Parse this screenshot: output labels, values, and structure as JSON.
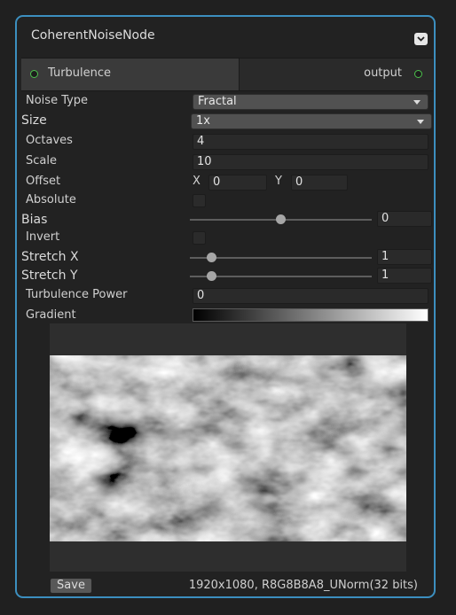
{
  "node": {
    "title": "CoherentNoiseNode",
    "collapse_icon": "chevron-down-icon",
    "accent_color": "#3c8fbf"
  },
  "ports": {
    "input_label": "Turbulence",
    "output_label": "output",
    "port_color": "#4cc24c"
  },
  "properties": {
    "noise_type": {
      "label": "Noise Type",
      "value": "Fractal"
    },
    "size": {
      "label": "Size",
      "value": "1x"
    },
    "octaves": {
      "label": "Octaves",
      "value": "4"
    },
    "scale": {
      "label": "Scale",
      "value": "10"
    },
    "offset": {
      "label": "Offset",
      "x_label": "X",
      "x_value": "0",
      "y_label": "Y",
      "y_value": "0"
    },
    "absolute": {
      "label": "Absolute",
      "checked": false
    },
    "bias": {
      "label": "Bias",
      "value": "0",
      "slider_fraction": 0.5
    },
    "invert": {
      "label": "Invert",
      "checked": false
    },
    "stretch_x": {
      "label": "Stretch X",
      "value": "1",
      "slider_fraction": 0.12
    },
    "stretch_y": {
      "label": "Stretch Y",
      "value": "1",
      "slider_fraction": 0.12
    },
    "turbulence_power": {
      "label": "Turbulence Power",
      "value": "0"
    },
    "gradient": {
      "label": "Gradient",
      "from_color": "#000000",
      "to_color": "#ffffff"
    }
  },
  "preview": {
    "save_label": "Save",
    "info": "1920x1080, R8G8B8A8_UNorm(32 bits)"
  }
}
